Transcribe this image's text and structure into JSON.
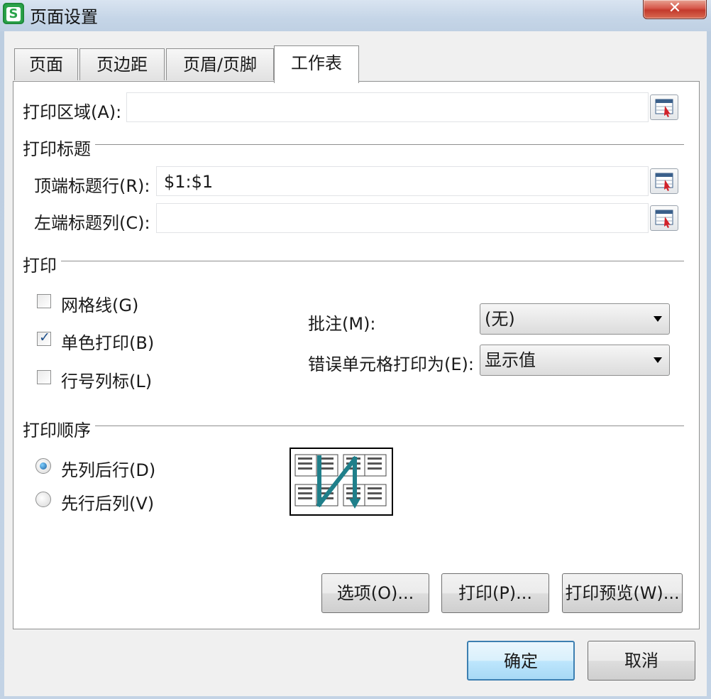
{
  "window": {
    "title": "页面设置",
    "app_icon_letter": "S",
    "close_glyph": "✕"
  },
  "tabs": [
    {
      "label": "页面"
    },
    {
      "label": "页边距"
    },
    {
      "label": "页眉/页脚"
    },
    {
      "label": "工作表",
      "active": true
    }
  ],
  "print_area": {
    "label": "打印区域(A):",
    "value": ""
  },
  "print_titles": {
    "group_label": "打印标题",
    "rows_label": "顶端标题行(R):",
    "rows_value": "$1:$1",
    "cols_label": "左端标题列(C):",
    "cols_value": ""
  },
  "print": {
    "group_label": "打印",
    "gridlines": {
      "label": "网格线(G)",
      "checked": false
    },
    "mono": {
      "label": "单色打印(B)",
      "checked": true
    },
    "headings": {
      "label": "行号列标(L)",
      "checked": false
    },
    "comments_label": "批注(M):",
    "comments_value": "(无)",
    "errors_label": "错误单元格打印为(E):",
    "errors_value": "显示值"
  },
  "order": {
    "group_label": "打印顺序",
    "down_then_over": {
      "label": "先列后行(D)",
      "selected": true
    },
    "over_then_down": {
      "label": "先行后列(V)",
      "selected": false
    }
  },
  "buttons": {
    "options": "选项(O)...",
    "print": "打印(P)...",
    "preview": "打印预览(W)...",
    "ok": "确定",
    "cancel": "取消"
  },
  "check_glyph": "✓",
  "colors": {
    "accent": "#3c7fb1",
    "arrow": "#1f7f8a"
  }
}
